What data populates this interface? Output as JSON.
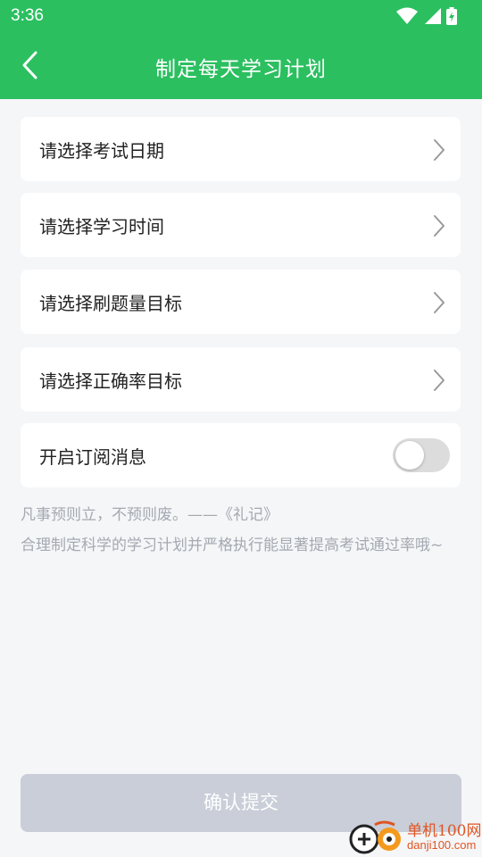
{
  "status_bar": {
    "time": "3:36"
  },
  "nav": {
    "title": "制定每天学习计划"
  },
  "items": [
    {
      "label": "请选择考试日期"
    },
    {
      "label": "请选择学习时间"
    },
    {
      "label": "请选择刷题量目标"
    },
    {
      "label": "请选择正确率目标"
    }
  ],
  "subscribe": {
    "label": "开启订阅消息",
    "enabled": false
  },
  "quote": {
    "line1": "凡事预则立，不预则废。——《礼记》",
    "line2": "合理制定科学的学习计划并严格执行能显著提高考试通过率哦~"
  },
  "submit": {
    "label": "确认提交"
  },
  "watermark": {
    "brand": "单机100网",
    "domain": "danji100.com"
  },
  "colors": {
    "primary": "#2bbf60",
    "background": "#f5f6f8",
    "disabled_button": "#c9ced8",
    "muted_text": "#a4a9b1"
  }
}
